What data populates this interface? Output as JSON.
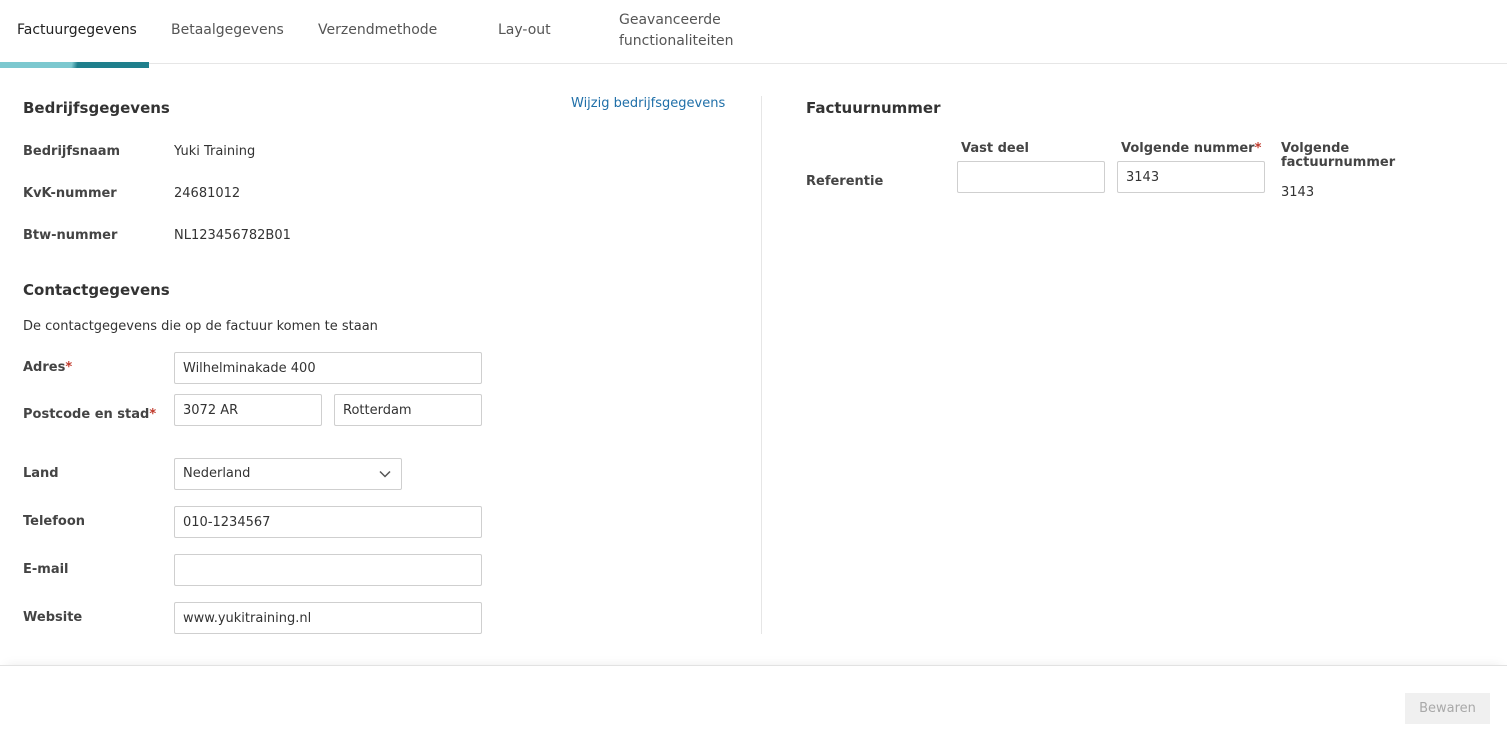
{
  "tabs": [
    {
      "label": "Factuurgegevens",
      "active": true
    },
    {
      "label": "Betaalgegevens",
      "active": false
    },
    {
      "label": "Verzendmethode",
      "active": false
    },
    {
      "label": "Lay-out",
      "active": false
    },
    {
      "label_line1": "Geavanceerde",
      "label_line2": "functionaliteiten",
      "active": false
    }
  ],
  "company": {
    "heading": "Bedrijfsgegevens",
    "edit_link": "Wijzig bedrijfsgegevens",
    "name_label": "Bedrijfsnaam",
    "name_value": "Yuki Training",
    "kvk_label": "KvK-nummer",
    "kvk_value": "24681012",
    "vat_label": "Btw-nummer",
    "vat_value": "NL123456782B01"
  },
  "contact": {
    "heading": "Contactgegevens",
    "description": "De contactgegevens die op de factuur komen te staan",
    "address_label": "Adres",
    "address_value": "Wilhelminakade 400",
    "postal_city_label": "Postcode en stad",
    "postal_value": "3072 AR",
    "city_value": "Rotterdam",
    "country_label": "Land",
    "country_value": "Nederland",
    "phone_label": "Telefoon",
    "phone_value": "010-1234567",
    "email_label": "E-mail",
    "email_value": "",
    "website_label": "Website",
    "website_value": "www.yukitraining.nl",
    "required_mark": "*"
  },
  "invoice_number": {
    "heading": "Factuurnummer",
    "fixed_part_label": "Vast deel",
    "next_number_label": "Volgende nummer",
    "next_invoice_label_line1": "Volgende",
    "next_invoice_label_line2": "factuurnummer",
    "reference_label": "Referentie",
    "fixed_part_value": "",
    "next_number_value": "3143",
    "next_invoice_value": "3143",
    "required_mark": "*"
  },
  "footer": {
    "save_label": "Bewaren"
  }
}
